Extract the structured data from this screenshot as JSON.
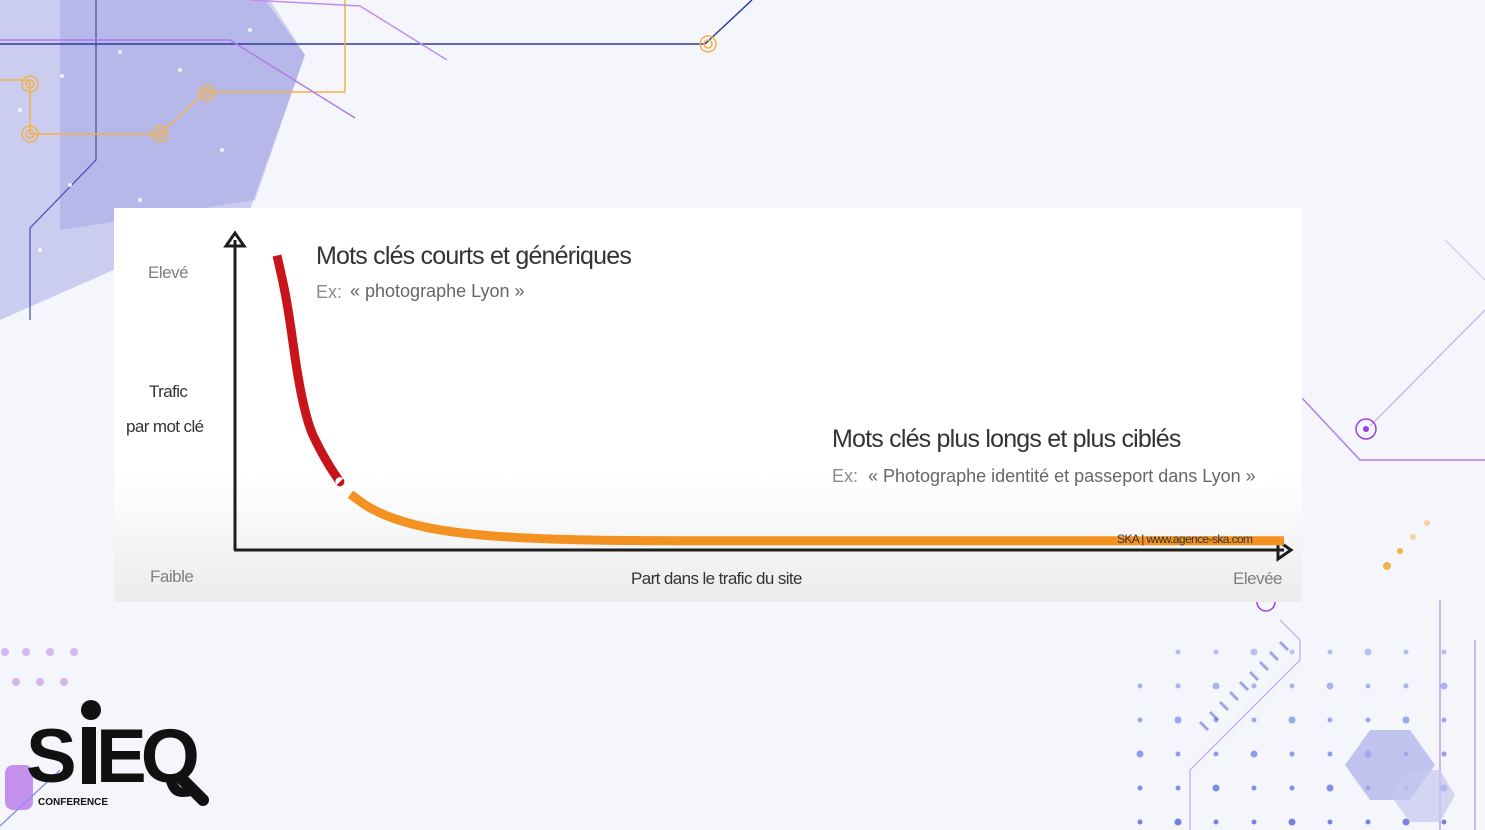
{
  "slide": {
    "logo": {
      "text": "SEQ",
      "subtext": "CONFERENCE"
    }
  },
  "chart_data": {
    "type": "line",
    "y_axis": {
      "high_label": "Elevé",
      "low_label": "Faible",
      "title_line1": "Trafic",
      "title_line2": "par mot clé"
    },
    "x_axis": {
      "title": "Part dans le trafic du site",
      "high_label": "Elevée"
    },
    "annotations": {
      "short": {
        "title": "Mots clés courts et génériques",
        "ex_prefix": "Ex:",
        "example": "« photographe Lyon  »"
      },
      "long": {
        "title": "Mots clés plus longs et plus ciblés",
        "ex_prefix": "Ex:",
        "example": "« Photographe identité et passeport dans Lyon »"
      }
    },
    "credit": "SKA | www.agence-ska.com",
    "colors": {
      "head_segment": "#c8151b",
      "tail_segment": "#f39121",
      "axis": "#1e1e1e"
    },
    "series": [
      {
        "segments": [
          {
            "role": "head",
            "color_key": "head_segment",
            "points": [
              [
                0.04,
                95
              ],
              [
                0.05,
                80
              ],
              [
                0.06,
                55
              ],
              [
                0.07,
                40
              ],
              [
                0.08,
                33
              ],
              [
                0.09,
                27
              ],
              [
                0.1,
                22
              ]
            ]
          },
          {
            "role": "tail",
            "color_key": "tail_segment",
            "points": [
              [
                0.11,
                18
              ],
              [
                0.13,
                13
              ],
              [
                0.16,
                9
              ],
              [
                0.2,
                6
              ],
              [
                0.26,
                4
              ],
              [
                0.35,
                3
              ],
              [
                0.5,
                3
              ],
              [
                0.7,
                3
              ],
              [
                1,
                3
              ]
            ]
          }
        ]
      }
    ],
    "xlim": [
      0,
      1
    ],
    "ylim": [
      0,
      100
    ]
  }
}
